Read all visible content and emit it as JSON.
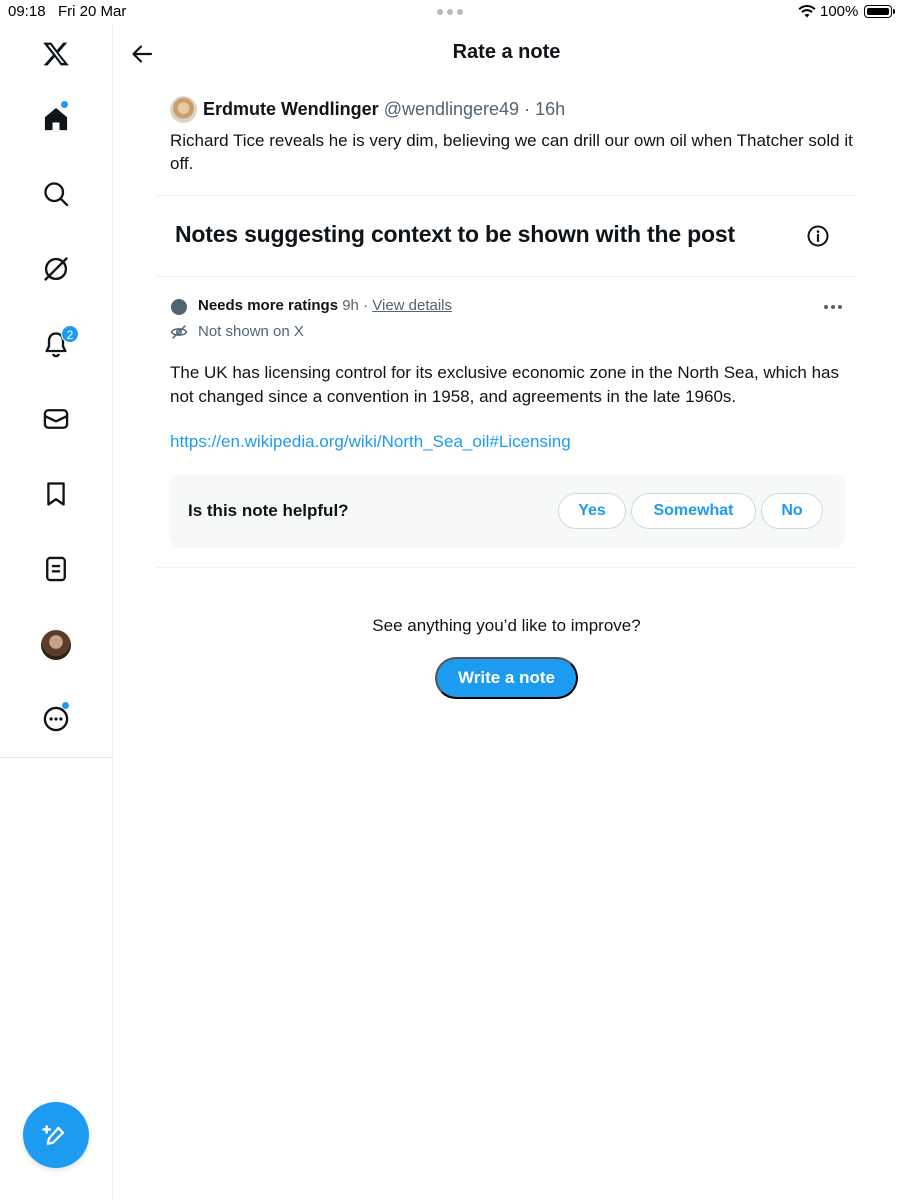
{
  "status_bar": {
    "time": "09:18",
    "date": "Fri 20 Mar",
    "battery": "100%"
  },
  "sidebar": {
    "notifications_badge": "2",
    "accent_color": "#1d9bf0"
  },
  "header": {
    "title": "Rate a note"
  },
  "post": {
    "author_name": "Erdmute Wendlinger",
    "author_handle": "@wendlingere49",
    "separator": "·",
    "age": "16h",
    "text": "Richard Tice reveals he is very dim, believing we can drill our own oil when Thatcher sold it off."
  },
  "notes_section": {
    "title": "Notes suggesting context to be shown with the post"
  },
  "note": {
    "status": "Needs more ratings",
    "age": "9h",
    "separator": "·",
    "view_details": "View details",
    "visibility": "Not shown on X",
    "text": "The UK has licensing control for its exclusive economic zone in the North Sea, which has not changed since a convention in 1958, and agreements in the late 1960s.",
    "link": "https://en.wikipedia.org/wiki/North_Sea_oil#Licensing"
  },
  "rating": {
    "question": "Is this note helpful?",
    "options": [
      "Yes",
      "Somewhat",
      "No"
    ]
  },
  "footer": {
    "prompt": "See anything you’d like to improve?",
    "write_note": "Write a note"
  }
}
